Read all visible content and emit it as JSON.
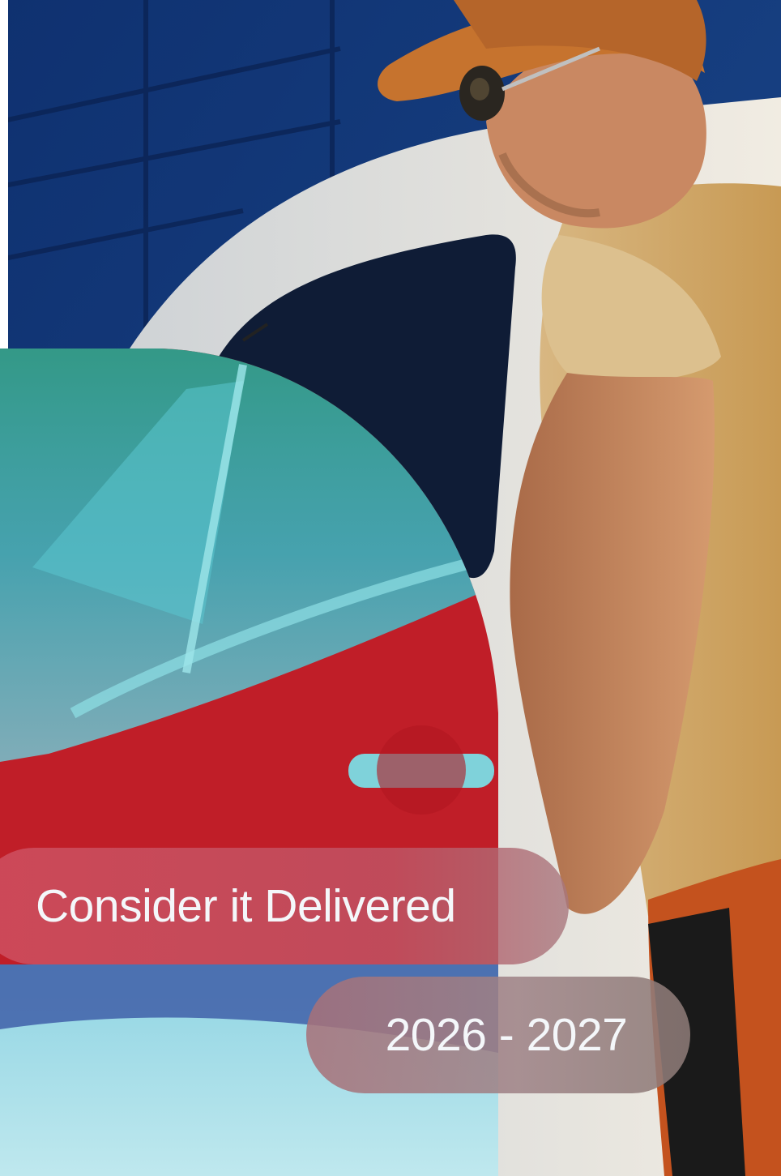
{
  "poster": {
    "tagline": "Consider it Delivered",
    "years": "2026 - 2027"
  },
  "colors": {
    "sky_building": "#163a78",
    "van_white": "#e8e4dc",
    "door_red": "#c0222a",
    "teal_overlay": "#2ab8c4",
    "shirt_tan": "#d9b47a",
    "cap_orange": "#c6732e",
    "skin": "#c98862",
    "text": "#f4f7fa"
  }
}
